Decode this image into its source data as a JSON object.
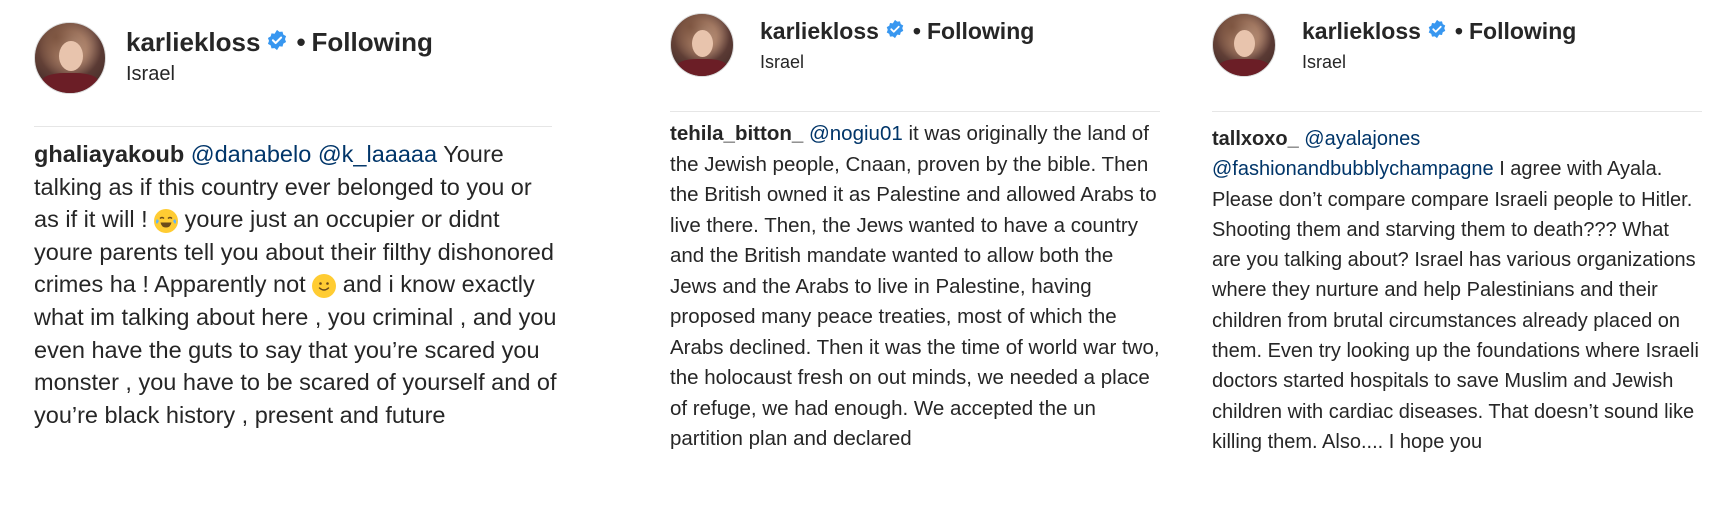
{
  "panels": [
    {
      "username": "karliekloss",
      "separator": "•",
      "follow_status": "Following",
      "location": "Israel",
      "comment": {
        "author": "ghaliayakoub",
        "mentions": [
          "@danabelo",
          "@k_laaaaa"
        ],
        "text_part1": "Youre talking as if this country ever belonged to you or as if it will !",
        "emoji1": "face-with-tears-of-joy",
        "text_part2": "youre just an occupier or didnt youre parents tell you about their filthy dishonored crimes ha ! Apparently not",
        "emoji2": "slightly-smiling-face",
        "text_part3": "and i know exactly what im talking about here , you criminal , and you even have the guts to say that you’re scared you monster , you have to be scared of yourself and of you’re black history , present and future"
      }
    },
    {
      "username": "karliekloss",
      "separator": "•",
      "follow_status": "Following",
      "location": "Israel",
      "comment": {
        "author": "tehila_bitton_",
        "mentions": [
          "@nogiu01"
        ],
        "text": "it was originally the land of the Jewish people, Cnaan, proven by the bible. Then the British owned it as Palestine and allowed Arabs to live there. Then, the Jews wanted to have a country and the British mandate wanted to allow both the Jews and the Arabs to live in Palestine, having proposed many peace treaties, most of which the Arabs declined. Then it was the time of world war two, the holocaust fresh on out minds, we needed a place of refuge, we had enough. We accepted the un partition plan and declared"
      }
    },
    {
      "username": "karliekloss",
      "separator": "•",
      "follow_status": "Following",
      "location": "Israel",
      "comment": {
        "author": "tallxoxo_",
        "mentions": [
          "@ayalajones",
          "@fashionandbubblychampagne"
        ],
        "text": "I agree with Ayala. Please don’t compare compare Israeli people to Hitler. Shooting them and starving them to death??? What are you talking about? Israel has various organizations where they nurture and help Palestinians and their children from brutal circumstances already placed on them. Even try looking up the foundations where Israeli doctors started hospitals to save Muslim and Jewish children with cardiac diseases. That doesn’t sound like killing them. Also.... I hope you"
      }
    }
  ],
  "colors": {
    "text": "#262626",
    "mention": "#003569",
    "verified": "#3897f0",
    "divider": "#e6e6e6"
  }
}
